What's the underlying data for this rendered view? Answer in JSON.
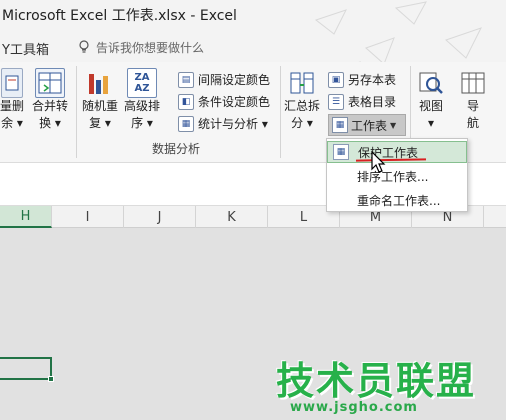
{
  "window": {
    "title": "Microsoft Excel 工作表.xlsx - Excel"
  },
  "tellrow": {
    "tab_fragment": "Y工具箱",
    "tell_me": "告诉我你想要做什么"
  },
  "ribbon": {
    "group_label": "数据分析",
    "buttons": {
      "delete": [
        "量删",
        "余 ▾"
      ],
      "merge": [
        "合并转",
        "换 ▾"
      ],
      "shuffle": [
        "随机重",
        "复 ▾"
      ],
      "adv_sort": [
        "高级排",
        "序 ▾"
      ],
      "summary": [
        "汇总拆",
        "分 ▾"
      ],
      "view": [
        "视图",
        "▾"
      ],
      "nav": [
        "导",
        "航"
      ]
    },
    "small": {
      "interval": "间隔设定颜色",
      "cond": "条件设定颜色",
      "stats": "统计与分析 ▾",
      "save_sheet": "另存本表",
      "toc": "表格目录",
      "worksheet": "工作表"
    },
    "icons": {
      "merge": "ZA",
      "sort": "AZ"
    }
  },
  "menu": {
    "items": [
      "保护工作表",
      "排序工作表...",
      "重命名工作表..."
    ]
  },
  "grid": {
    "columns": [
      "H",
      "I",
      "J",
      "K",
      "L",
      "M",
      "N"
    ],
    "active_column": "H"
  },
  "watermark": {
    "title": "技术员联盟",
    "url": "www.jsgho.com"
  },
  "colors": {
    "excel_green": "#217346",
    "watermark_green": "#27b14a",
    "highlight": "#d4e8d8"
  }
}
